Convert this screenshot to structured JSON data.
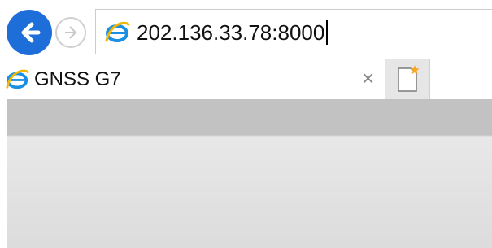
{
  "address_bar": {
    "url": "202.136.33.78:8000"
  },
  "tabs": [
    {
      "title": "GNSS G7",
      "close_glyph": "×"
    }
  ],
  "icons": {
    "back": "back-arrow-icon",
    "forward": "forward-arrow-icon",
    "site": "internet-explorer-icon",
    "new_tab": "new-tab-icon"
  },
  "colors": {
    "accent": "#1d6ed8",
    "new_tab_star": "#f5a623"
  }
}
